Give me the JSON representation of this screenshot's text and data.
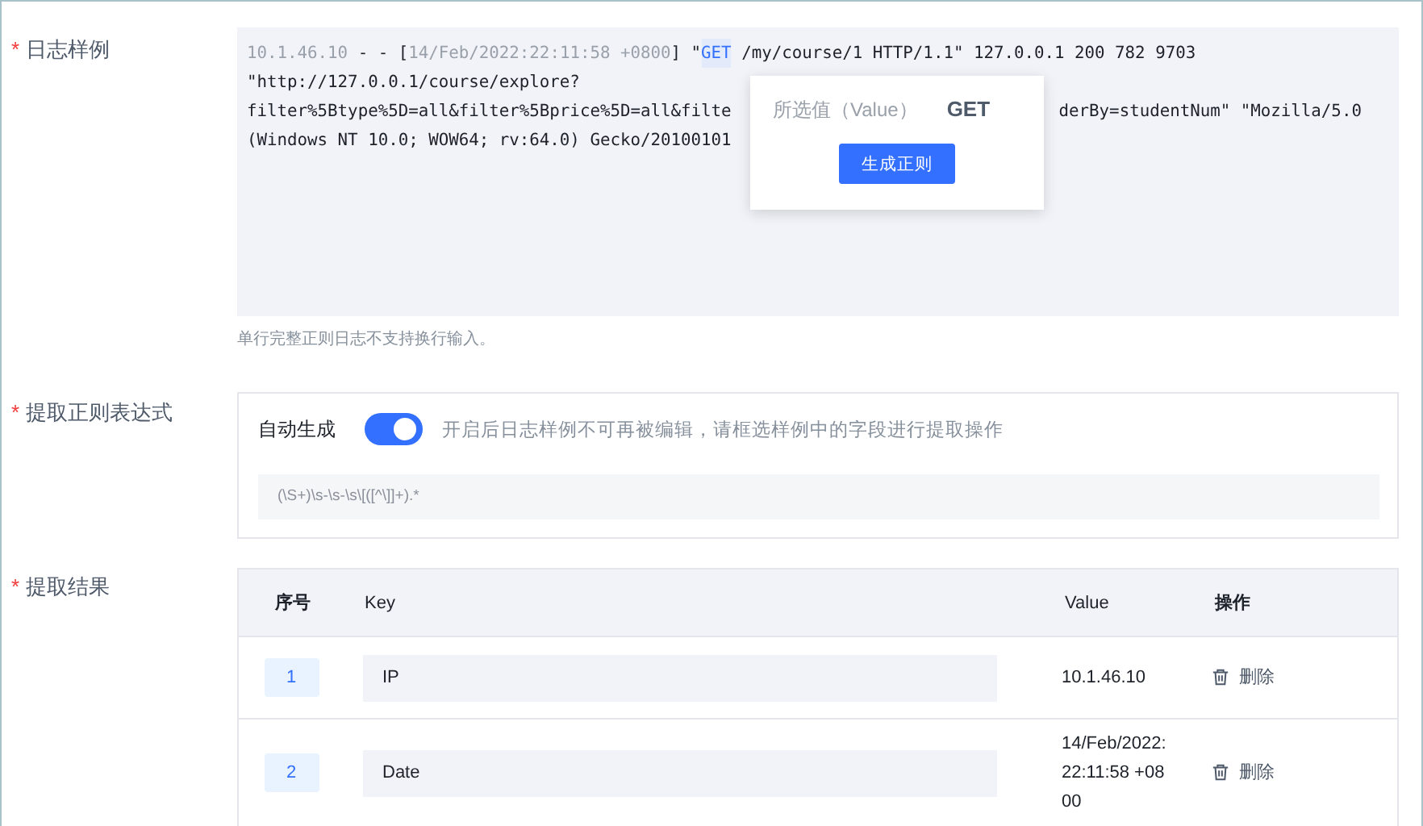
{
  "log_sample": {
    "label": "日志样例",
    "required": true,
    "required_mark": "*",
    "lines": [
      [
        {
          "text": "10.1.46.10",
          "kind": "extracted"
        },
        {
          "text": " - - [",
          "kind": "plain"
        },
        {
          "text": "14/Feb/2022:22:11:58 +0800",
          "kind": "extracted"
        },
        {
          "text": "] \"",
          "kind": "plain"
        },
        {
          "text": "GET",
          "kind": "selected"
        },
        {
          "text": " /my/course/1 HTTP/1.1\" 127.0.0.1 200 782 9703",
          "kind": "plain"
        }
      ],
      [
        {
          "text": "\"http://127.0.0.1/course/explore?",
          "kind": "plain"
        }
      ],
      [
        {
          "text": "filter%5Btype%5D=all&filter%5Bprice%5D=all&filte",
          "kind": "plain"
        },
        {
          "text": "derBy=studentNum\" \"Mozilla/5.0",
          "kind": "after-popover"
        }
      ],
      [
        {
          "text": "(Windows NT 10.0; WOW64; rv:64.0) Gecko/20100101",
          "kind": "plain"
        }
      ]
    ],
    "popover": {
      "label": "所选值（Value）",
      "value": "GET",
      "button": "生成正则"
    },
    "help": "单行完整正则日志不支持换行输入。"
  },
  "regex": {
    "label": "提取正则表达式",
    "required": true,
    "required_mark": "*",
    "auto_label": "自动生成",
    "auto_on": true,
    "hint": "开启后日志样例不可再被编辑，请框选样例中的字段进行提取操作",
    "value": "(\\S+)\\s-\\s-\\s\\[([^\\]]+).*",
    "disabled": true
  },
  "results": {
    "label": "提取结果",
    "required": true,
    "required_mark": "*",
    "columns": [
      "序号",
      "Key",
      "Value",
      "操作"
    ],
    "rows": [
      {
        "index": "1",
        "key": "IP",
        "value": "10.1.46.10",
        "action": "删除"
      },
      {
        "index": "2",
        "key": "Date",
        "value": "14/Feb/2022:22:11:58 +0800",
        "action": "删除"
      }
    ]
  }
}
